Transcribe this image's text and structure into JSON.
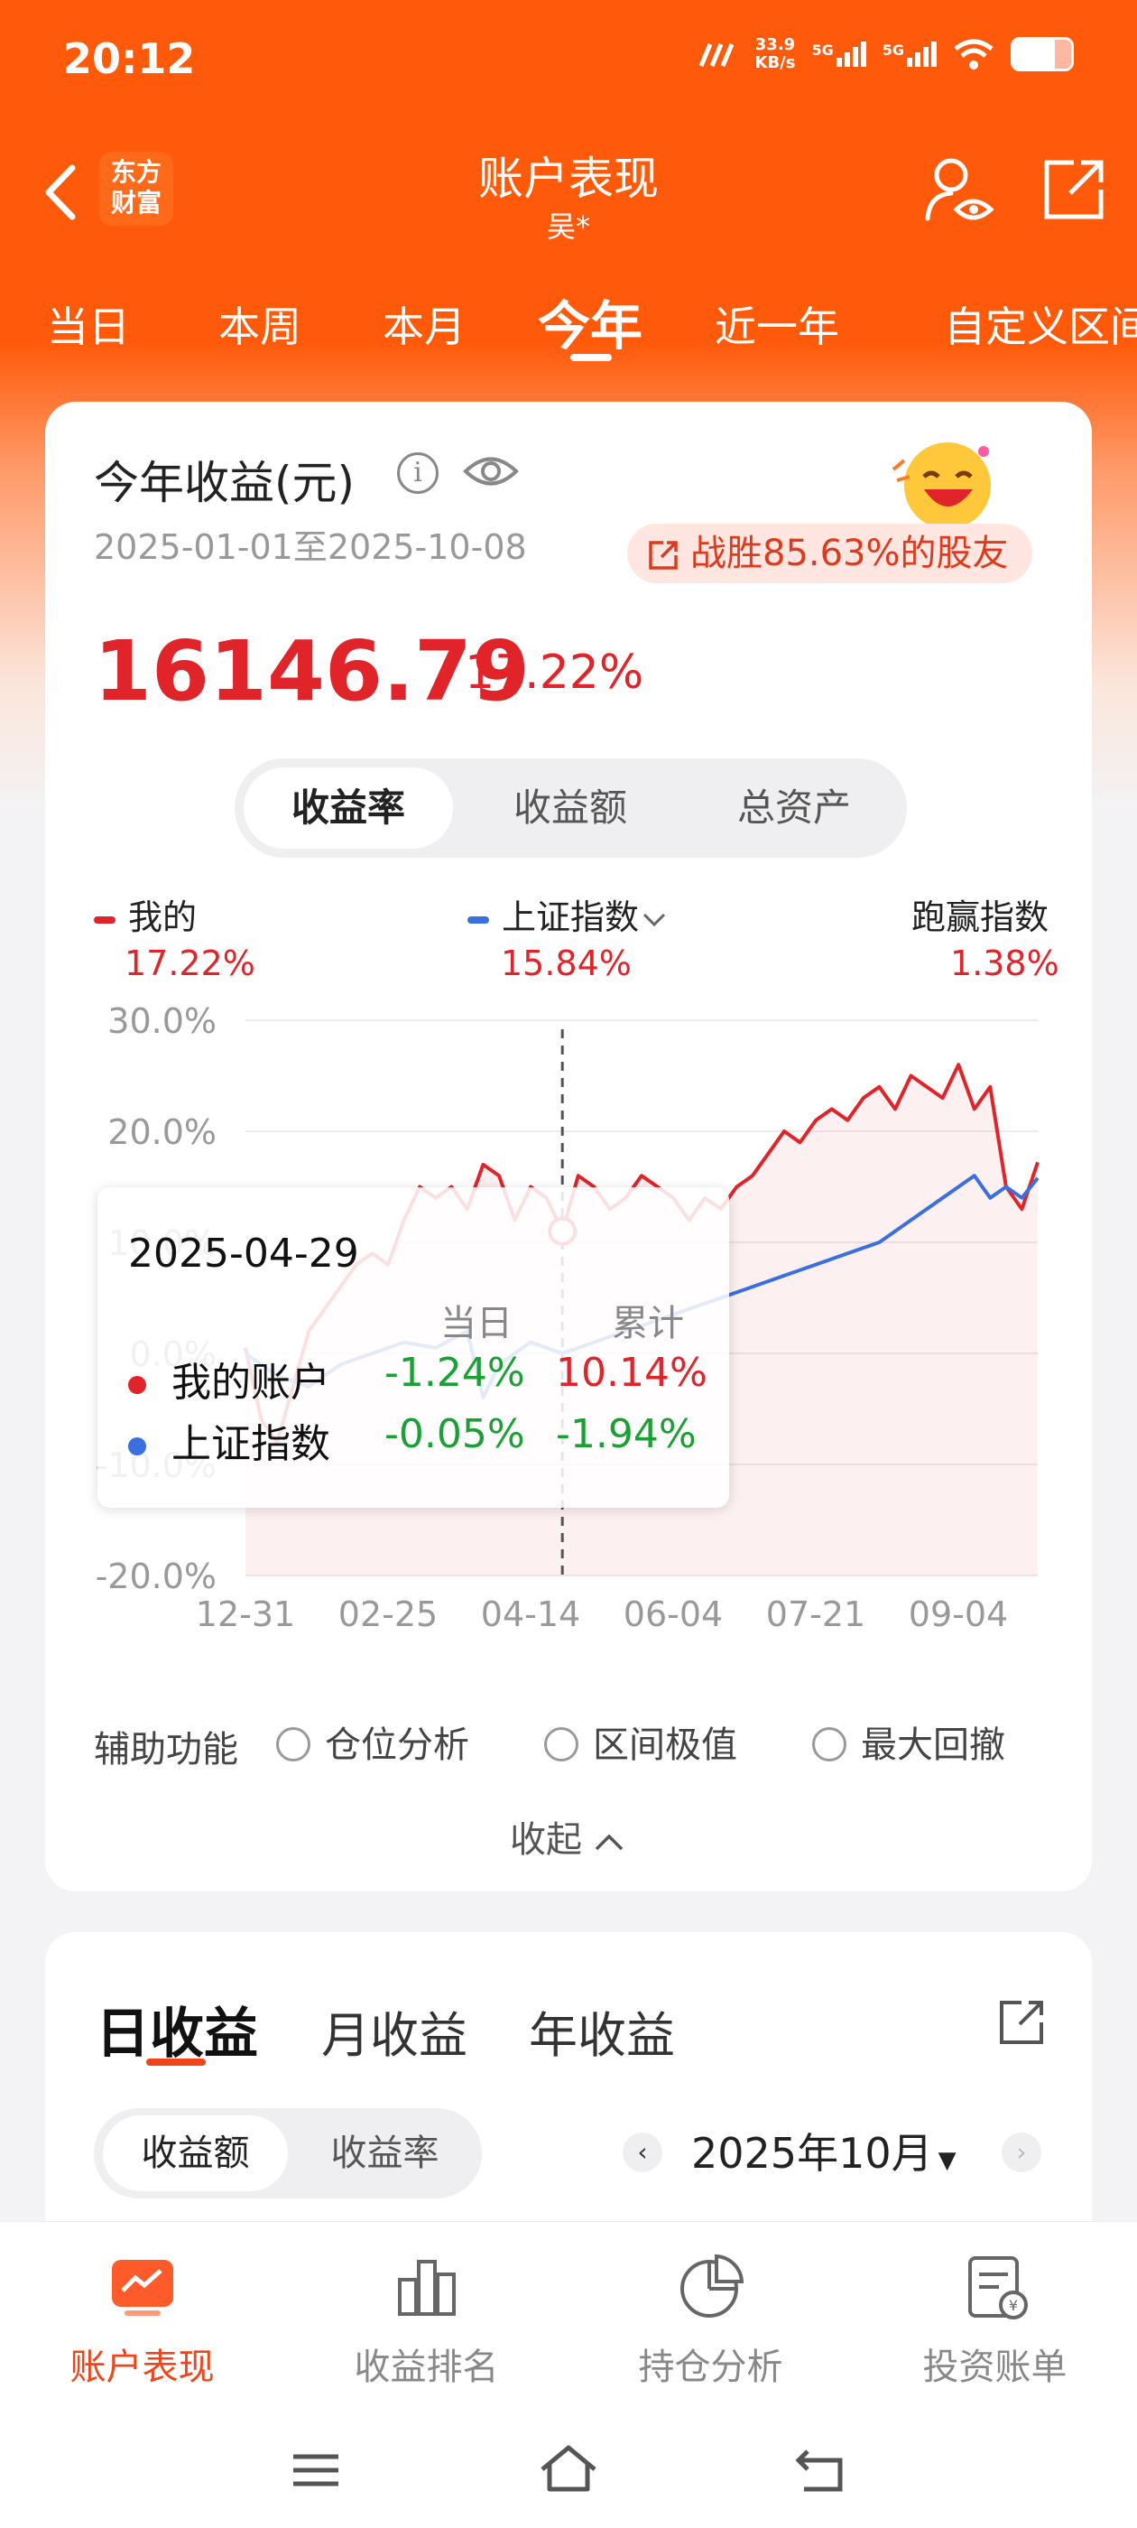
{
  "status_bar": {
    "time": "20:12",
    "net_speed_value": "33.9",
    "net_speed_unit": "KB/s",
    "sim1": "5G",
    "sim2": "5G",
    "battery_icon": "battery-icon"
  },
  "header": {
    "logo_line1": "东方",
    "logo_line2": "财富",
    "title": "账户表现",
    "subtitle": "吴*"
  },
  "period_tabs": [
    {
      "label": "当日",
      "active": false
    },
    {
      "label": "本周",
      "active": false
    },
    {
      "label": "本月",
      "active": false
    },
    {
      "label": "今年",
      "active": true
    },
    {
      "label": "近一年",
      "active": false
    },
    {
      "label": "自定义区间",
      "active": false
    }
  ],
  "summary": {
    "title": "今年收益(元)",
    "date_range": "2025-01-01至2025-10-08",
    "beat_text": "战胜85.63%的股友",
    "profit": "16146.79",
    "profit_pct": "17.22%"
  },
  "view_toggle": [
    "收益率",
    "收益额",
    "总资产"
  ],
  "legend": [
    {
      "name": "我的",
      "value": "17.22%",
      "color": "#e0242a"
    },
    {
      "name": "上证指数",
      "value": "15.84%",
      "color": "#3a6fe0"
    },
    {
      "name": "跑赢指数",
      "value": "1.38%",
      "color": "#e0242a"
    }
  ],
  "chart_data": {
    "type": "line",
    "y_ticks": [
      "30.0%",
      "20.0%",
      "10.0%",
      "0.0%",
      "-10.0%",
      "-20.0%"
    ],
    "x_ticks": [
      "12-31",
      "02-25",
      "04-14",
      "06-04",
      "07-21",
      "09-04"
    ],
    "ylim": [
      -20,
      30
    ],
    "series": [
      {
        "name": "我的",
        "color": "#e0242a",
        "x": [
          0,
          2,
          4,
          6,
          8,
          10,
          12,
          14,
          16,
          18,
          20,
          22,
          24,
          26,
          28,
          30,
          32,
          34,
          36,
          38,
          40,
          42,
          44,
          46,
          48,
          50,
          52,
          54,
          56,
          58,
          60,
          62,
          64,
          66,
          68,
          70,
          72,
          74,
          76,
          78,
          80,
          82,
          84,
          86,
          88,
          90,
          92,
          94,
          96,
          98,
          100
        ],
        "y": [
          0.5,
          -6,
          -8,
          -3,
          2,
          4,
          6,
          8,
          9,
          8,
          12,
          15,
          14,
          15,
          13,
          17,
          16,
          12,
          15,
          14,
          11,
          16,
          15,
          13,
          14,
          16,
          15,
          14,
          12,
          14,
          13,
          15,
          16,
          18,
          20,
          19,
          21,
          22,
          21,
          23,
          24,
          22,
          25,
          24,
          23,
          26,
          22,
          24,
          15,
          13,
          17.2
        ]
      },
      {
        "name": "上证指数",
        "color": "#3a6fe0",
        "x": [
          0,
          4,
          8,
          12,
          16,
          20,
          24,
          28,
          30,
          32,
          36,
          40,
          44,
          48,
          52,
          56,
          60,
          64,
          68,
          72,
          76,
          80,
          84,
          88,
          90,
          92,
          94,
          96,
          98,
          100
        ],
        "y": [
          0,
          -2,
          -3,
          -1,
          0,
          1,
          0.5,
          2,
          -4,
          -1,
          1,
          0,
          1,
          2,
          3,
          4,
          5,
          6,
          7,
          8,
          9,
          10,
          12,
          14,
          15,
          16,
          14,
          15,
          14,
          15.8
        ]
      }
    ],
    "crosshair_x": 40
  },
  "tooltip": {
    "date": "2025-04-29",
    "col_day": "当日",
    "col_total": "累计",
    "rows": [
      {
        "name": "我的账户",
        "day": "-1.24%",
        "total": "10.14%",
        "color": "#e0242a"
      },
      {
        "name": "上证指数",
        "day": "-0.05%",
        "total": "-1.94%",
        "color": "#3a6fe0"
      }
    ]
  },
  "aux": {
    "label": "辅助功能",
    "options": [
      "仓位分析",
      "区间极值",
      "最大回撤"
    ],
    "collapse": "收起"
  },
  "daily_card": {
    "tabs": [
      "日收益",
      "月收益",
      "年收益"
    ],
    "toggle": [
      "收益额",
      "收益率"
    ],
    "month": "2025年10月"
  },
  "bottom_nav": [
    {
      "label": "账户表现",
      "icon": "chart-trend-icon",
      "active": true
    },
    {
      "label": "收益排名",
      "icon": "bar-rank-icon",
      "active": false
    },
    {
      "label": "持仓分析",
      "icon": "pie-chart-icon",
      "active": false
    },
    {
      "label": "投资账单",
      "icon": "bill-icon",
      "active": false
    }
  ]
}
